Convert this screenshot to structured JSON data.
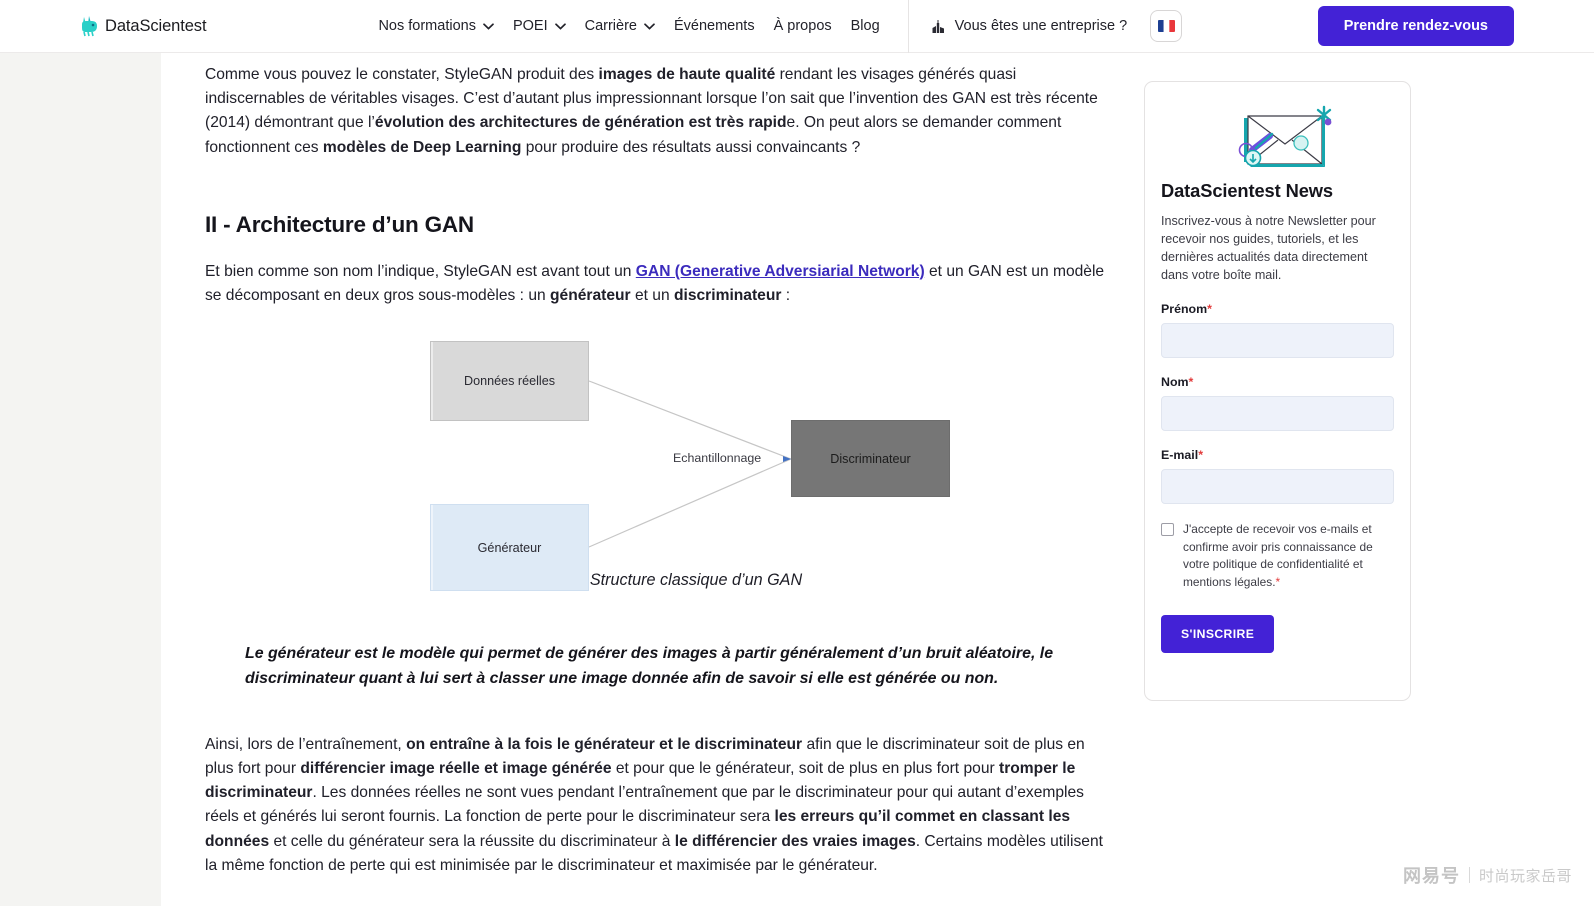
{
  "header": {
    "brand": "DataScientest",
    "brand_icon": "datascientest-logo-icon",
    "nav": [
      {
        "label": "Nos formations",
        "has_dropdown": true
      },
      {
        "label": "POEI",
        "has_dropdown": true
      },
      {
        "label": "Carrière",
        "has_dropdown": true
      },
      {
        "label": "Événements",
        "has_dropdown": false
      },
      {
        "label": "À propos",
        "has_dropdown": false
      },
      {
        "label": "Blog",
        "has_dropdown": false
      }
    ],
    "enterprise_label": "Vous êtes une entreprise ?",
    "enterprise_icon": "building-icon",
    "language_icon": "french-flag-icon",
    "cta_label": "Prendre rendez-vous",
    "cta_color": "#4322d6"
  },
  "article": {
    "intro": {
      "p1_a": "Comme vous pouvez le constater, StyleGAN produit des ",
      "p1_b1": "images de haute qualité",
      "p1_b": " rendant les visages générés quasi indiscernables de véritables visages. C’est d’autant plus impressionnant lorsque l’on sait que l’invention des GAN est très récente (2014) démontrant que l’",
      "p1_b2": "évolution des architectures de génération est très rapid",
      "p1_c": "e. On peut alors se demander comment fonctionnent ces ",
      "p1_b3": "modèles de Deep Learning",
      "p1_d": " pour produire des résultats aussi convaincants ?"
    },
    "section_title": "II - Architecture d’un GAN",
    "section_intro": {
      "a": "Et bien comme son nom l’indique, StyleGAN est avant tout un ",
      "link": "GAN (Generative Adversiarial Network)",
      "b": " et un GAN est un modèle se décomposant en deux gros sous-modèles : un ",
      "bold1": "générateur",
      "c": " et un ",
      "bold2": "discriminateur",
      "d": " :"
    },
    "diagram": {
      "box_real": "Données réelles",
      "box_generator": "Générateur",
      "box_discriminator": "Discriminateur",
      "edge_label": "Echantillonnage",
      "caption": "Structure classique d’un GAN",
      "colors": {
        "real": "#d9d9d9",
        "generator": "#deeaf6",
        "discriminator": "#767676"
      }
    },
    "quote": "Le générateur est le modèle qui permet de générer des images à partir généralement d’un bruit aléatoire, le discriminateur quant à lui sert à classer une image donnée afin de savoir si elle est générée ou non.",
    "body": {
      "a": "Ainsi, lors de l’entraînement, ",
      "b1": "on entraîne à la fois le générateur et le discriminateur",
      "b": " afin que le discriminateur soit de plus en plus fort pour ",
      "b2": "différencier image réelle et image générée",
      "c": " et pour que le générateur, soit de plus en plus fort pour ",
      "b3": "tromper le discriminateur",
      "d": ". Les données réelles ne sont vues pendant l’entraînement que par le discriminateur pour qui autant d’exemples réels et générés lui seront fournis. La fonction de perte pour le discriminateur sera ",
      "b4": "les erreurs qu’il commet en classant les données",
      "e": " et celle du générateur sera la réussite du discriminateur à ",
      "b5": "le différencier des vraies images",
      "f": ". Certains modèles utilisent la même fonction de perte qui est minimisée par le discriminateur et maximisée par le générateur."
    }
  },
  "newsletter": {
    "illustration_icon": "envelope-newsletter-icon",
    "title": "DataScientest News",
    "description": "Inscrivez-vous à notre Newsletter pour recevoir nos guides, tutoriels, et les dernières actualités data directement dans votre boîte mail.",
    "fields": [
      {
        "label": "Prénom",
        "required": "*",
        "value": "",
        "placeholder": ""
      },
      {
        "label": "Nom",
        "required": "*",
        "value": "",
        "placeholder": ""
      },
      {
        "label": "E-mail",
        "required": "*",
        "value": "",
        "placeholder": ""
      }
    ],
    "consent": "J'accepte de recevoir vos e-mails et confirme avoir pris connaissance de votre politique de confidentialité et mentions légales.",
    "consent_required": "*",
    "submit_label": "S'INSCRIRE",
    "submit_color": "#4322d6"
  },
  "watermark": {
    "logo": "网易号",
    "name": "时尚玩家岳哥"
  }
}
